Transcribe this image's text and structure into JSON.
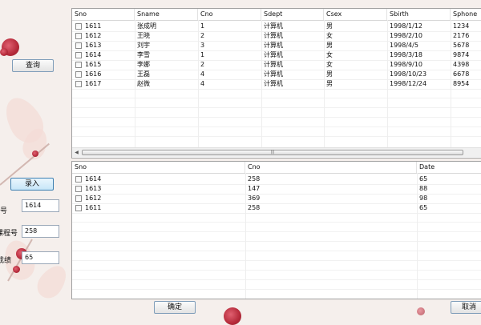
{
  "buttons": {
    "query": "查询",
    "enter": "录入",
    "confirm": "确定",
    "cancel": "取消"
  },
  "fields": [
    {
      "label": "学号",
      "label_visible": "号",
      "value": "1614"
    },
    {
      "label": "课程号",
      "label_visible": "课程号",
      "value": "258"
    },
    {
      "label": "成绩",
      "label_visible": "成绩",
      "value": "65"
    }
  ],
  "student_table": {
    "columns": [
      "Sno",
      "Sname",
      "Cno",
      "Sdept",
      "Csex",
      "Sbirth",
      "Sphone"
    ],
    "rows": [
      [
        "1611",
        "张成明",
        "1",
        "计算机",
        "男",
        "1998/1/12",
        "1234"
      ],
      [
        "1612",
        "王晓",
        "2",
        "计算机",
        "女",
        "1998/2/10",
        "2176"
      ],
      [
        "1613",
        "刘宇",
        "3",
        "计算机",
        "男",
        "1998/4/5",
        "5678"
      ],
      [
        "1614",
        "李雪",
        "1",
        "计算机",
        "女",
        "1998/3/18",
        "9874"
      ],
      [
        "1615",
        "李娜",
        "2",
        "计算机",
        "女",
        "1998/9/10",
        "4398"
      ],
      [
        "1616",
        "王磊",
        "4",
        "计算机",
        "男",
        "1998/10/23",
        "6678"
      ],
      [
        "1617",
        "赵微",
        "4",
        "计算机",
        "男",
        "1998/12/24",
        "8954"
      ]
    ]
  },
  "score_table": {
    "columns": [
      "Sno",
      "Cno",
      "Date"
    ],
    "rows": [
      [
        "1614",
        "258",
        "65"
      ],
      [
        "1613",
        "147",
        "88"
      ],
      [
        "1612",
        "369",
        "98"
      ],
      [
        "1611",
        "258",
        "65"
      ]
    ]
  },
  "icons": {
    "scroll_left": "arrow-left-icon",
    "scroll_grip": "grip-icon"
  },
  "colors": {
    "accent_blossom": "#b52a3a",
    "background": "#f5efec",
    "focus_button": "#c7e6f8"
  }
}
